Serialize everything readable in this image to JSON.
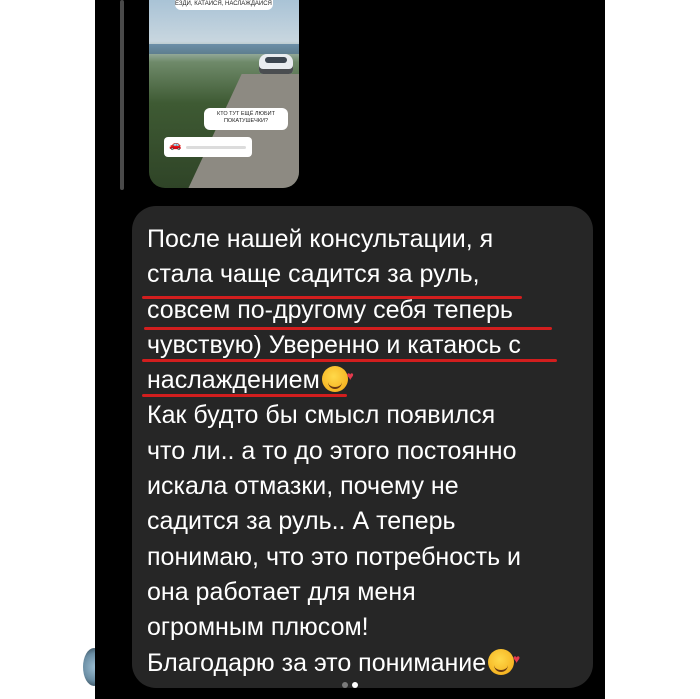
{
  "story_reply": {
    "caption_top": "ЕЗДИ, КАТАЙСЯ, НАСЛАЖДАЙСЯ 😂",
    "question_sticker": "КТО ТУТ ЕЩЁ ЛЮБИТ ПОКАТУШЕЧКИ?",
    "slider_emoji": "🚗"
  },
  "message": {
    "lines": [
      "После нашей консультации, я",
      "стала чаще садится за руль,",
      "совсем по-другому себя теперь",
      "чувствую) Уверенно и катаюсь с",
      "наслаждением",
      "Как будто бы смысл появился",
      "что ли.. а то до этого постоянно",
      "искала отмазки, почему не",
      "садится за руль.. А теперь",
      "понимаю, что это потребность и",
      "она работает для меня",
      "огромным плюсом!",
      "Благодарю за это понимание"
    ],
    "emoji_name": "smiling-face-with-hearts-icon",
    "underline_color": "#d21e1e",
    "bubble_color": "#262626"
  },
  "carousel": {
    "pages": 2,
    "active": 2
  }
}
